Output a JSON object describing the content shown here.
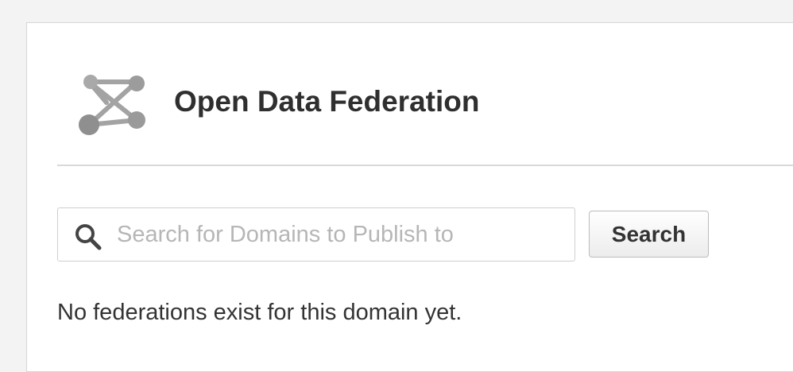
{
  "header": {
    "title": "Open Data Federation",
    "logo_icon": "network-graph-icon"
  },
  "search": {
    "placeholder": "Search for Domains to Publish to",
    "value": "",
    "icon": "search-icon",
    "button_label": "Search"
  },
  "status": {
    "empty_message": "No federations exist for this domain yet."
  },
  "colors": {
    "title_text": "#2f2f2f",
    "placeholder_text": "#b6b6b6",
    "logo_gray": "#9a9a9a"
  }
}
